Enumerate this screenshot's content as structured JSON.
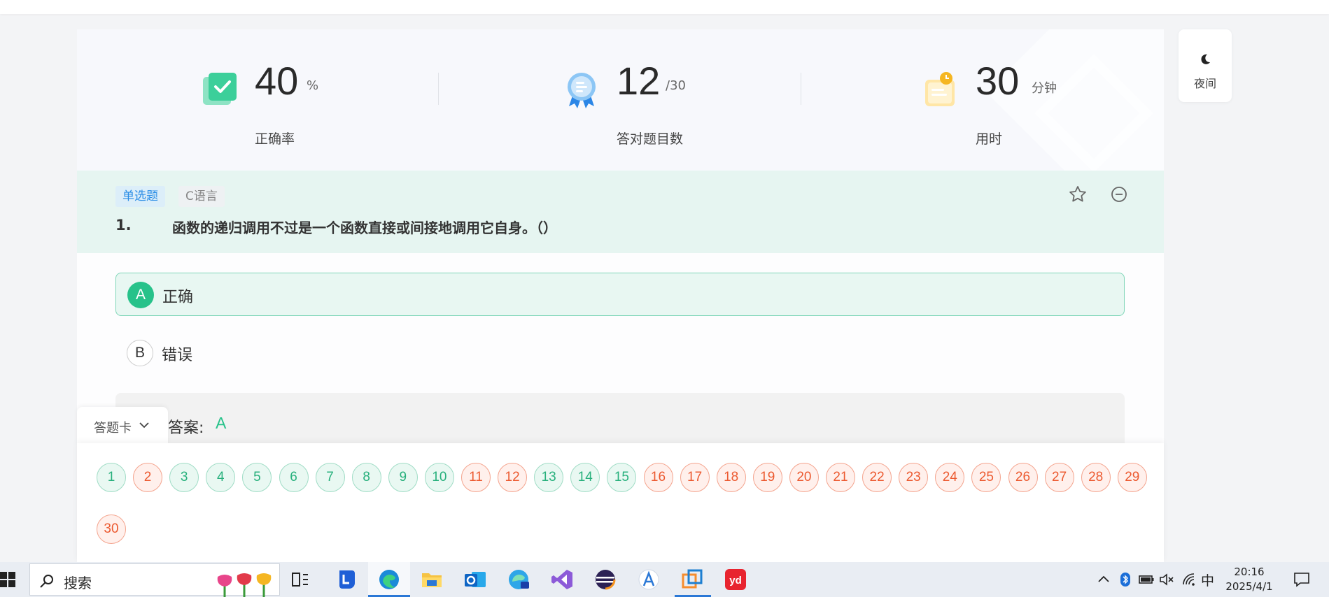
{
  "stats": {
    "accuracy": {
      "value": "40",
      "unit": "%",
      "label": "正确率"
    },
    "correct": {
      "value": "12",
      "unit": "/30",
      "label": "答对题目数"
    },
    "time": {
      "value": "30",
      "unit": "分钟",
      "label": "用时"
    }
  },
  "night_mode": {
    "label": "夜间",
    "icon": "moon-icon"
  },
  "question": {
    "type_tag": "单选题",
    "subject_tag": "C语言",
    "number": "1.",
    "text": "函数的递归调用不过是一个函数直接或间接地调用它自身。（）"
  },
  "options": [
    {
      "key": "A",
      "text": "正确",
      "selected": true
    },
    {
      "key": "B",
      "text": "错误",
      "selected": false
    }
  ],
  "answer": {
    "label": "答案:",
    "value": "A"
  },
  "answer_sheet": {
    "tab_label": "答题卡",
    "items": [
      {
        "n": "1",
        "correct": true
      },
      {
        "n": "2",
        "correct": false
      },
      {
        "n": "3",
        "correct": true
      },
      {
        "n": "4",
        "correct": true
      },
      {
        "n": "5",
        "correct": true
      },
      {
        "n": "6",
        "correct": true
      },
      {
        "n": "7",
        "correct": true
      },
      {
        "n": "8",
        "correct": true
      },
      {
        "n": "9",
        "correct": true
      },
      {
        "n": "10",
        "correct": true
      },
      {
        "n": "11",
        "correct": false
      },
      {
        "n": "12",
        "correct": false
      },
      {
        "n": "13",
        "correct": true
      },
      {
        "n": "14",
        "correct": true
      },
      {
        "n": "15",
        "correct": true
      },
      {
        "n": "16",
        "correct": false
      },
      {
        "n": "17",
        "correct": false
      },
      {
        "n": "18",
        "correct": false
      },
      {
        "n": "19",
        "correct": false
      },
      {
        "n": "20",
        "correct": false
      },
      {
        "n": "21",
        "correct": false
      },
      {
        "n": "22",
        "correct": false
      },
      {
        "n": "23",
        "correct": false
      },
      {
        "n": "24",
        "correct": false
      },
      {
        "n": "25",
        "correct": false
      },
      {
        "n": "26",
        "correct": false
      },
      {
        "n": "27",
        "correct": false
      },
      {
        "n": "28",
        "correct": false
      },
      {
        "n": "29",
        "correct": false
      },
      {
        "n": "30",
        "correct": false
      }
    ]
  },
  "colors": {
    "correct": "#27c28a",
    "wrong": "#ec5a30",
    "accent_blue": "#2b8ee6"
  },
  "taskbar": {
    "search_label": "搜索",
    "apps": [
      "task-view-icon",
      "lenovo-icon",
      "edge-icon",
      "file-explorer-icon",
      "outlook-icon",
      "edge-ai-icon",
      "visual-studio-icon",
      "eclipse-icon",
      "app-a-icon",
      "vmware-icon",
      "youdao-icon"
    ],
    "ime": "中",
    "time": "20:16",
    "date": "2025/4/1"
  }
}
